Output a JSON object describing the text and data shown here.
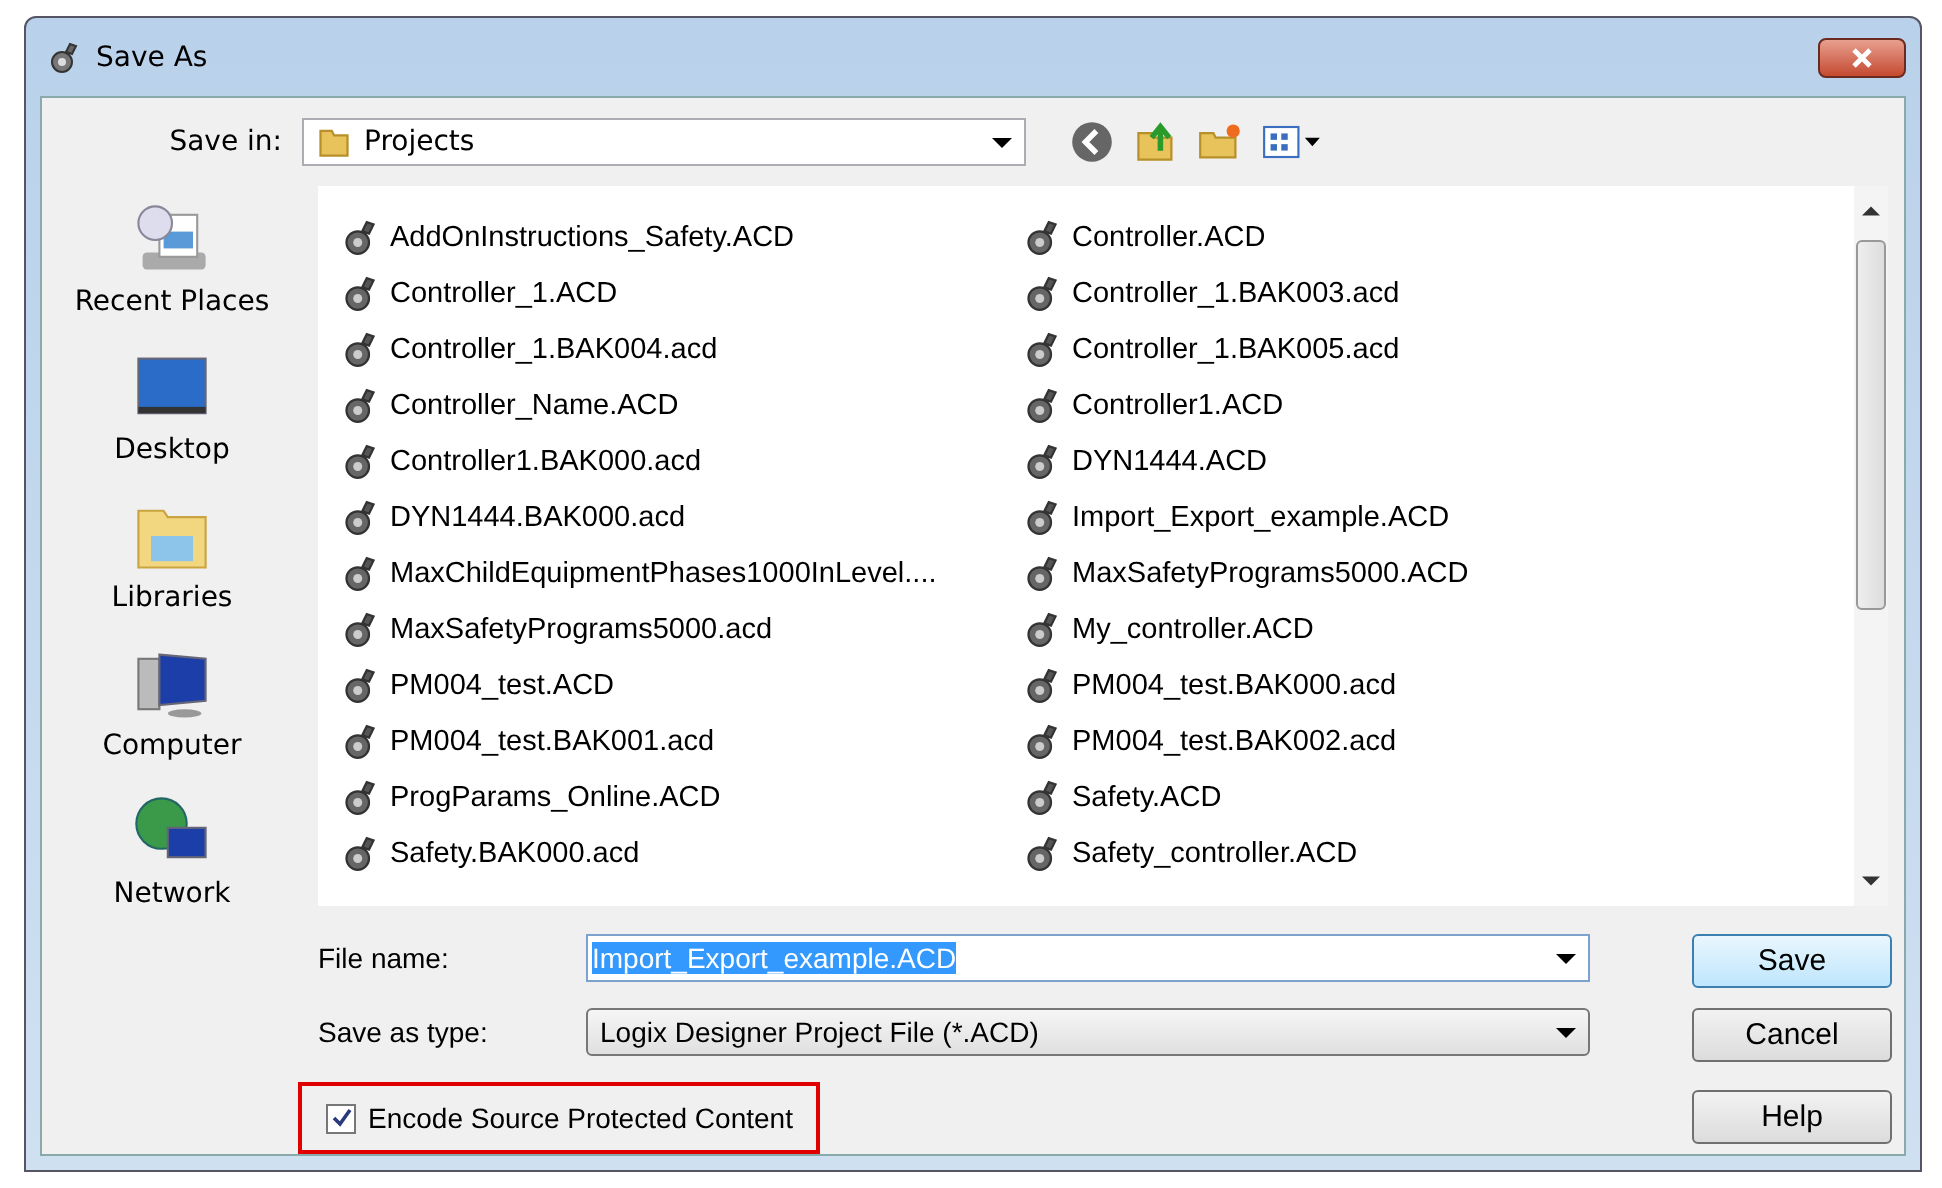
{
  "window": {
    "title": "Save As"
  },
  "save_in": {
    "label": "Save in:",
    "value": "Projects"
  },
  "places": [
    {
      "label": "Recent Places",
      "kind": "recent"
    },
    {
      "label": "Desktop",
      "kind": "desktop"
    },
    {
      "label": "Libraries",
      "kind": "libraries"
    },
    {
      "label": "Computer",
      "kind": "computer"
    },
    {
      "label": "Network",
      "kind": "network"
    }
  ],
  "files": [
    "AddOnInstructions_Safety.ACD",
    "Controller.ACD",
    "Controller_1.ACD",
    "Controller_1.BAK003.acd",
    "Controller_1.BAK004.acd",
    "Controller_1.BAK005.acd",
    "Controller_Name.ACD",
    "Controller1.ACD",
    "Controller1.BAK000.acd",
    "DYN1444.ACD",
    "DYN1444.BAK000.acd",
    "Import_Export_example.ACD",
    "MaxChildEquipmentPhases1000InLevel....",
    "MaxSafetyPrograms5000.ACD",
    "MaxSafetyPrograms5000.acd",
    "My_controller.ACD",
    "PM004_test.ACD",
    "PM004_test.BAK000.acd",
    "PM004_test.BAK001.acd",
    "PM004_test.BAK002.acd",
    "ProgParams_Online.ACD",
    "Safety.ACD",
    "Safety.BAK000.acd",
    "Safety_controller.ACD"
  ],
  "file_name": {
    "label": "File name:",
    "value": "Import_Export_example.ACD",
    "text_selected": true
  },
  "save_as_type": {
    "label": "Save as type:",
    "value": "Logix Designer Project File (*.ACD)"
  },
  "option": {
    "label": "Encode Source Protected Content",
    "checked": true,
    "highlighted": true
  },
  "buttons": [
    {
      "label": "Save",
      "default": true
    },
    {
      "label": "Cancel",
      "default": false
    },
    {
      "label": "Help",
      "default": false
    }
  ]
}
